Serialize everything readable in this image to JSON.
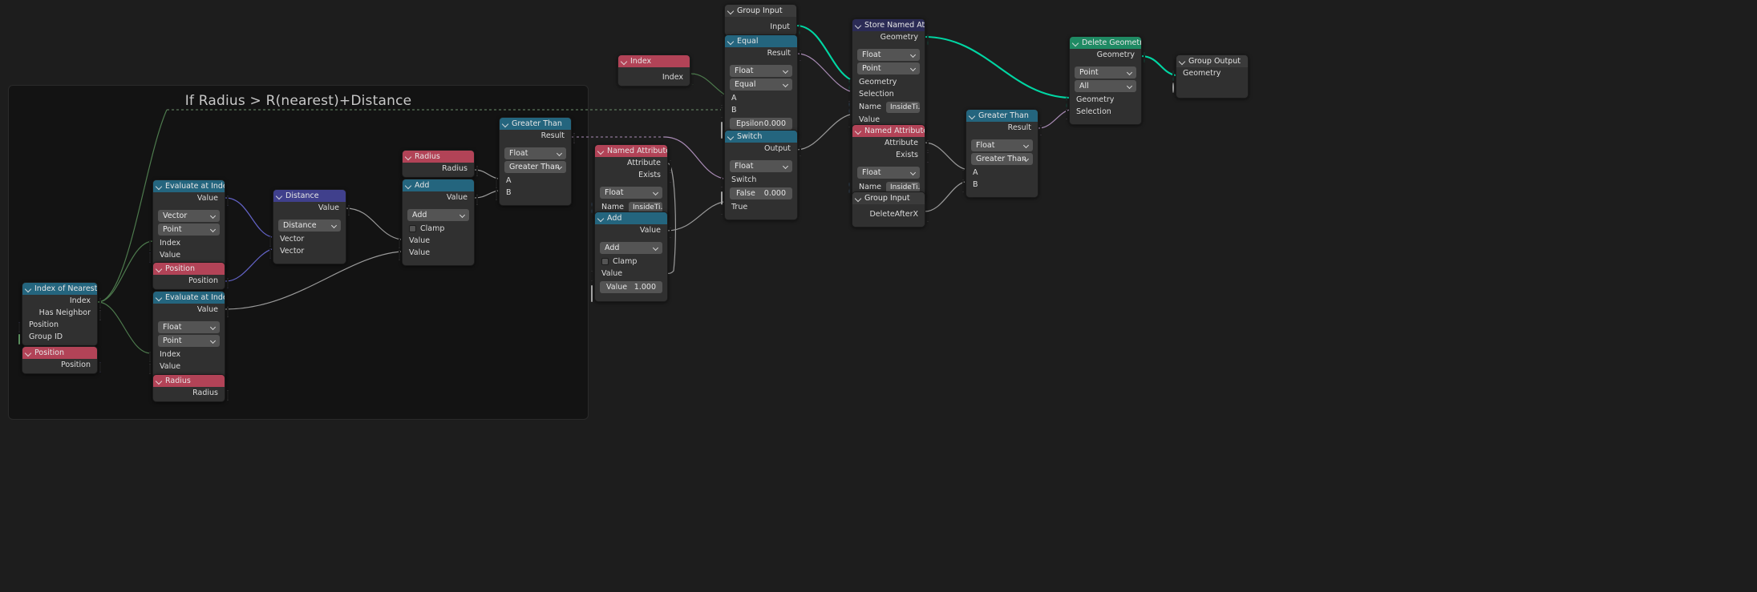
{
  "editor": {
    "background_color": "#1d1d1d",
    "frame": {
      "label": "If Radius > R(nearest)+Distance"
    }
  },
  "colors": {
    "input_header": "#b24357",
    "converter_header": "#24657e",
    "vector_header": "#40408c",
    "geometry_header": "#1f8a63",
    "attribute_header": "#2b2b55",
    "group_header": "#3b3b3b",
    "socket_float": "#a1a1a1",
    "socket_vector": "#6363c7",
    "socket_geometry": "#00d6a3",
    "socket_boolean": "#cca6d6",
    "socket_integer": "#598c5c",
    "socket_string": "#70b2ff"
  },
  "nodes": {
    "index_of_nearest": {
      "title": "Index of Nearest",
      "outputs": [
        {
          "label": "Index",
          "type": "integer"
        },
        {
          "label": "Has Neighbor",
          "type": "boolean"
        }
      ],
      "inputs": [
        {
          "label": "Position",
          "type": "vector"
        },
        {
          "label": "Group ID",
          "type": "integer"
        }
      ]
    },
    "position_a": {
      "title": "Position",
      "outputs": [
        {
          "label": "Position",
          "type": "vector"
        }
      ]
    },
    "eval_at_index_vec": {
      "title": "Evaluate at Index",
      "outputs": [
        {
          "label": "Value",
          "type": "vector"
        }
      ],
      "dropdowns": [
        "Vector",
        "Point"
      ],
      "inputs": [
        {
          "label": "Index",
          "type": "integer"
        },
        {
          "label": "Value",
          "type": "vector"
        }
      ]
    },
    "position_b": {
      "title": "Position",
      "outputs": [
        {
          "label": "Position",
          "type": "vector"
        }
      ]
    },
    "eval_at_index_float": {
      "title": "Evaluate at Index",
      "outputs": [
        {
          "label": "Value",
          "type": "float"
        }
      ],
      "dropdowns": [
        "Float",
        "Point"
      ],
      "inputs": [
        {
          "label": "Index",
          "type": "integer"
        },
        {
          "label": "Value",
          "type": "float"
        }
      ]
    },
    "radius_b": {
      "title": "Radius",
      "outputs": [
        {
          "label": "Radius",
          "type": "float"
        }
      ]
    },
    "distance": {
      "title": "Distance",
      "outputs": [
        {
          "label": "Value",
          "type": "float"
        }
      ],
      "dropdowns": [
        "Distance"
      ],
      "inputs": [
        {
          "label": "Vector",
          "type": "vector"
        },
        {
          "label": "Vector",
          "type": "vector"
        }
      ]
    },
    "radius_a": {
      "title": "Radius",
      "outputs": [
        {
          "label": "Radius",
          "type": "float"
        }
      ]
    },
    "add_left": {
      "title": "Add",
      "outputs": [
        {
          "label": "Value",
          "type": "float"
        }
      ],
      "dropdowns": [
        "Add"
      ],
      "checkbox": "Clamp",
      "inputs": [
        {
          "label": "Value",
          "type": "float"
        },
        {
          "label": "Value",
          "type": "float"
        }
      ]
    },
    "greater_than_left": {
      "title": "Greater Than",
      "outputs": [
        {
          "label": "Result",
          "type": "boolean"
        }
      ],
      "dropdowns": [
        "Float",
        "Greater Than"
      ],
      "inputs": [
        {
          "label": "A",
          "type": "float"
        },
        {
          "label": "B",
          "type": "float"
        }
      ]
    },
    "index_node": {
      "title": "Index",
      "outputs": [
        {
          "label": "Index",
          "type": "integer"
        }
      ]
    },
    "named_attribute_mid": {
      "title": "Named Attribute",
      "outputs": [
        {
          "label": "Attribute",
          "type": "float"
        },
        {
          "label": "Exists",
          "type": "boolean"
        }
      ],
      "dropdowns": [
        "Float"
      ],
      "name_field": {
        "label": "Name",
        "value": "InsideTi..."
      }
    },
    "add_mid": {
      "title": "Add",
      "outputs": [
        {
          "label": "Value",
          "type": "float"
        }
      ],
      "dropdowns": [
        "Add"
      ],
      "checkbox": "Clamp",
      "inputs": [
        {
          "label": "Value",
          "type": "float"
        }
      ],
      "value_widget": {
        "label": "Value",
        "value": "1.000"
      }
    },
    "group_input_top": {
      "title": "Group Input",
      "outputs": [
        {
          "label": "Input",
          "type": "geometry"
        }
      ]
    },
    "equal": {
      "title": "Equal",
      "outputs": [
        {
          "label": "Result",
          "type": "boolean"
        }
      ],
      "dropdowns": [
        "Float",
        "Equal"
      ],
      "inputs": [
        {
          "label": "A",
          "type": "float"
        },
        {
          "label": "B",
          "type": "float"
        }
      ],
      "value_widget": {
        "label": "Epsilon",
        "value": "0.000"
      }
    },
    "switch": {
      "title": "Switch",
      "outputs": [
        {
          "label": "Output",
          "type": "float"
        }
      ],
      "dropdowns": [
        "Float"
      ],
      "inputs": [
        {
          "label": "Switch",
          "type": "boolean"
        }
      ],
      "value_widget": {
        "label": "False",
        "value": "0.000"
      },
      "inputs_after": [
        {
          "label": "True",
          "type": "float"
        }
      ]
    },
    "store_named_attribute": {
      "title": "Store Named Attribute",
      "outputs": [
        {
          "label": "Geometry",
          "type": "geometry"
        }
      ],
      "dropdowns": [
        "Float",
        "Point"
      ],
      "inputs": [
        {
          "label": "Geometry",
          "type": "geometry"
        },
        {
          "label": "Selection",
          "type": "boolean"
        }
      ],
      "name_field": {
        "label": "Name",
        "value": "InsideTi..."
      },
      "inputs_after": [
        {
          "label": "Value",
          "type": "float"
        }
      ]
    },
    "named_attribute_right": {
      "title": "Named Attribute",
      "outputs": [
        {
          "label": "Attribute",
          "type": "float"
        },
        {
          "label": "Exists",
          "type": "boolean"
        }
      ],
      "dropdowns": [
        "Float"
      ],
      "name_field": {
        "label": "Name",
        "value": "InsideTi..."
      }
    },
    "group_input_right": {
      "title": "Group Input",
      "outputs": [
        {
          "label": "DeleteAfterX",
          "type": "float"
        }
      ]
    },
    "greater_than_right": {
      "title": "Greater Than",
      "outputs": [
        {
          "label": "Result",
          "type": "boolean"
        }
      ],
      "dropdowns": [
        "Float",
        "Greater Than"
      ],
      "inputs": [
        {
          "label": "A",
          "type": "float"
        },
        {
          "label": "B",
          "type": "float"
        }
      ]
    },
    "delete_geometry": {
      "title": "Delete Geometry",
      "outputs": [
        {
          "label": "Geometry",
          "type": "geometry"
        }
      ],
      "dropdowns": [
        "Point",
        "All"
      ],
      "inputs": [
        {
          "label": "Geometry",
          "type": "geometry"
        },
        {
          "label": "Selection",
          "type": "boolean"
        }
      ]
    },
    "group_output": {
      "title": "Group Output",
      "inputs": [
        {
          "label": "Geometry",
          "type": "geometry"
        }
      ],
      "extra_socket": true
    }
  }
}
